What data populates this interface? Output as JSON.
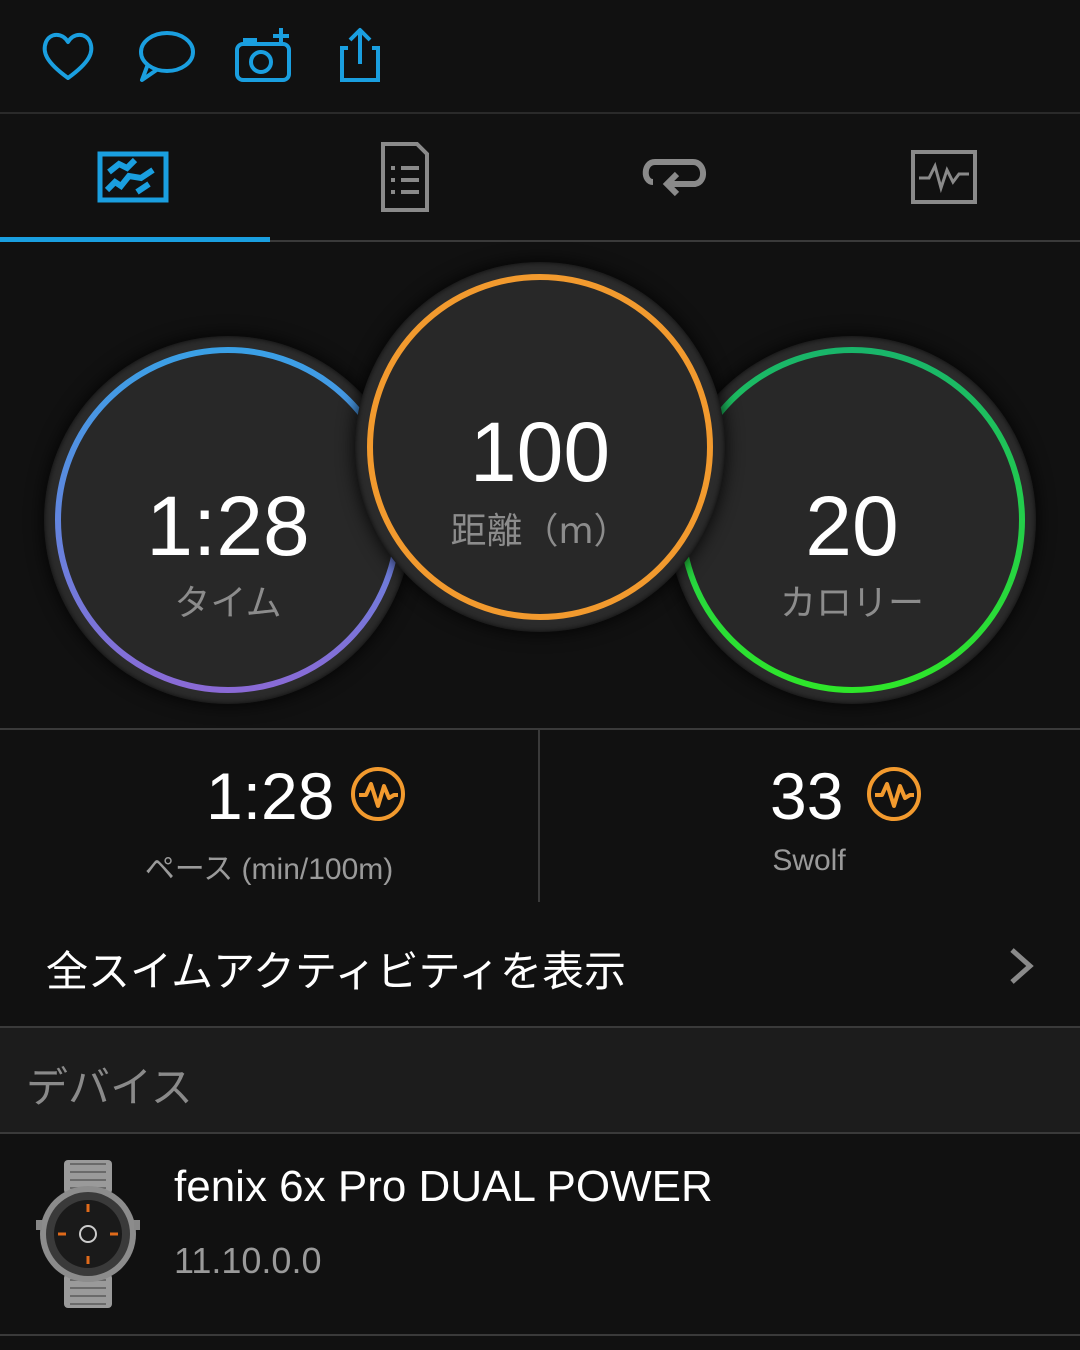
{
  "toolbar": {
    "icons": [
      "heart-icon",
      "comment-icon",
      "add-photo-icon",
      "share-icon"
    ],
    "accent": "#1a9fe0"
  },
  "tabs": [
    {
      "icon": "map-icon",
      "active": true
    },
    {
      "icon": "details-list-icon",
      "active": false
    },
    {
      "icon": "laps-icon",
      "active": false
    },
    {
      "icon": "charts-icon",
      "active": false
    }
  ],
  "summary": {
    "time": {
      "value": "1:28",
      "label": "タイム",
      "colors": [
        "#3aa0e6",
        "#8a6ad6"
      ]
    },
    "distance": {
      "value": "100",
      "label": "距離（m）",
      "color": "#f29a2e"
    },
    "calories": {
      "value": "20",
      "label": "カロリー",
      "colors": [
        "#19b56a",
        "#2ee62a"
      ]
    }
  },
  "stats": {
    "pace": {
      "value": "1:28",
      "label": "ペース (min/100m)",
      "icon": "pulse-icon"
    },
    "swolf": {
      "value": "33",
      "label": "Swolf",
      "icon": "pulse-icon"
    },
    "icon_color": "#f29a2e"
  },
  "all_swims": {
    "label": "全スイムアクティビティを表示"
  },
  "device_section": {
    "title": "デバイス"
  },
  "device": {
    "name": "fenix 6x Pro DUAL POWER",
    "firmware": "11.10.0.0"
  }
}
